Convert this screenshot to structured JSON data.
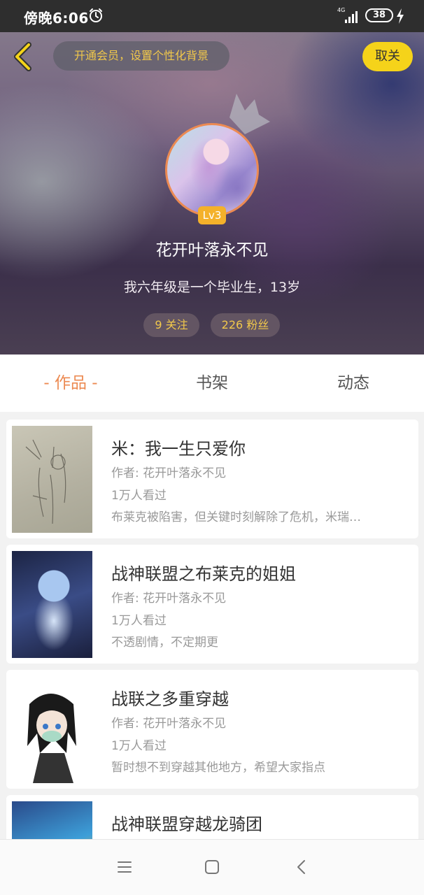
{
  "status_bar": {
    "time": "傍晚6:06",
    "network": "4G",
    "battery": "38"
  },
  "header": {
    "back_icon": "chevron-left-icon",
    "member_prompt": "开通会员，设置个性化背景",
    "cancel_label": "取关",
    "level": "Lv3",
    "username": "花开叶落永不见",
    "bio": "我六年级是一个毕业生，13岁",
    "following": "9 关注",
    "fans": "226 粉丝"
  },
  "tabs": [
    {
      "label": "- 作品 -",
      "active": true
    },
    {
      "label": "书架",
      "active": false
    },
    {
      "label": "动态",
      "active": false
    }
  ],
  "works": [
    {
      "title": "米：我一生只爱你",
      "author": "作者: 花开叶落永不见",
      "views": "1万人看过",
      "desc": "布莱克被陷害，但关键时刻解除了危机，米瑞…"
    },
    {
      "title": "战神联盟之布莱克的姐姐",
      "author": "作者: 花开叶落永不见",
      "views": "1万人看过",
      "desc": "不透剧情，不定期更"
    },
    {
      "title": "战联之多重穿越",
      "author": "作者: 花开叶落永不见",
      "views": "1万人看过",
      "desc": "暂时想不到穿越其他地方，希望大家指点"
    },
    {
      "title": "战神联盟穿越龙骑团",
      "author": "",
      "views": "",
      "desc": ""
    }
  ],
  "colors": {
    "accent_orange": "#ec8a52",
    "gold_text": "#f1c84b",
    "cancel_yellow": "#f5d31a",
    "level_badge": "#f4b12a"
  },
  "nav_icons": [
    "menu-icon",
    "home-square-icon",
    "back-triangle-icon"
  ]
}
